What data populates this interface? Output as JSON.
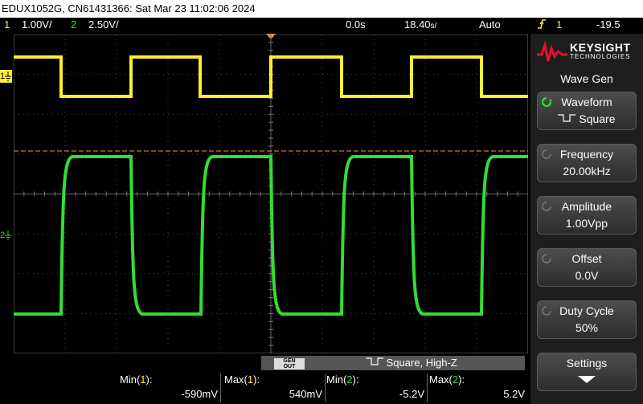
{
  "title_bar": "EDUX1052G, CN61431366: Sat Mar 23 11:02:06 2024",
  "status": {
    "ch1_num": "1",
    "ch1_scale": "1.00V/",
    "ch2_num": "2",
    "ch2_scale": "2.50V/",
    "time_offset": "0.0s",
    "time_scale": "18.40",
    "time_unit": "s/",
    "trigger_mode": "Auto",
    "trig_icon": "trigger-edge-icon",
    "trig_channel": "1",
    "trig_level": "-19.5"
  },
  "markers": {
    "ch1_marker": "1",
    "ch2_marker": "2"
  },
  "panel": {
    "brand_line1": "KEYSIGHT",
    "brand_line2": "TECHNOLOGIES",
    "menu_title": "Wave Gen",
    "softkeys": [
      {
        "label": "Waveform",
        "value": "Square"
      },
      {
        "label": "Frequency",
        "value": "20.00kHz"
      },
      {
        "label": "Amplitude",
        "value": "1.00Vpp"
      },
      {
        "label": "Offset",
        "value": "0.0V"
      },
      {
        "label": "Duty Cycle",
        "value": "50%"
      },
      {
        "label": "Settings",
        "value": ""
      }
    ]
  },
  "gen": {
    "out_label_1": "GEN",
    "out_label_2": "OUT",
    "summary": "Square, High-Z"
  },
  "measurements": [
    {
      "label_pre": "Min(",
      "chan": "1",
      "label_post": "):",
      "value": "-590mV",
      "color": "#ffee33"
    },
    {
      "label_pre": "Max(",
      "chan": "1",
      "label_post": "):",
      "value": "540mV",
      "color": "#ffee33"
    },
    {
      "label_pre": "Min(",
      "chan": "2",
      "label_post": "):",
      "value": "-5.2V",
      "color": "#33dd33"
    },
    {
      "label_pre": "Max(",
      "chan": "2",
      "label_post": "):",
      "value": "5.2V",
      "color": "#33dd33"
    }
  ],
  "colors": {
    "ch1": "#ffee33",
    "ch2": "#33dd33",
    "trigger_level": "#ff9933"
  }
}
